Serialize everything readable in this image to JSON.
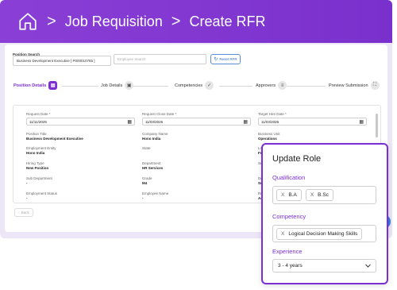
{
  "header": {
    "breadcrumbs": [
      "Job Requisition",
      "Create RFR"
    ]
  },
  "search": {
    "position_label": "Position Search",
    "position_value": "Business Development Executive [ P000010765 ]",
    "employee_placeholder": "Employee Search",
    "reset_label": "Reset RFR"
  },
  "steps": [
    {
      "label": "Position Details",
      "icon": "document-icon",
      "active": true
    },
    {
      "label": "Job Details",
      "icon": "briefcase-icon",
      "active": false
    },
    {
      "label": "Competencies",
      "icon": "check-circle-icon",
      "active": false
    },
    {
      "label": "Approvers",
      "icon": "list-icon",
      "active": false
    },
    {
      "label": "Preview Submission",
      "icon": "expand-icon",
      "active": false
    }
  ],
  "form": {
    "request_date_label": "Request Date *",
    "request_date_value": "11/11/2025",
    "close_date_label": "Request Close Date *",
    "close_date_value": "11/03/2026",
    "hire_date_label": "Target Hire Date *",
    "hire_date_value": "11/03/2026",
    "position_title_label": "Position Title",
    "position_title_value": "Business Development Executive",
    "company_name_label": "Company Name",
    "company_name_value": "Hono India",
    "business_unit_label": "Business Unit",
    "business_unit_value": "Operations",
    "employment_entity_label": "Employment Entity",
    "employment_entity_value": "Hono India",
    "state_label": "State",
    "state_value": "",
    "location_label": "Loca",
    "location_value": "Fran",
    "hiring_type_label": "Hiring Type",
    "hiring_type_value": "New Position",
    "department_label": "Department",
    "department_value": "HR Services",
    "section_label": "Secti",
    "sub_department_label": "Sub Department",
    "sub_department_value": "-",
    "grade_label": "Grade",
    "grade_value": "M4",
    "designation_label": "Desi",
    "designation_value": "Seni",
    "employment_status_label": "Employment Status",
    "employment_status_value": "-",
    "employee_name_label": "Employee Name",
    "employee_name_value": "-",
    "role_label": "Role",
    "role_value": "Assis"
  },
  "back_label": "Back",
  "panel": {
    "title": "Update Role",
    "qualification_label": "Qualification",
    "qualifications": [
      "B.A",
      "B.Sc"
    ],
    "competency_label": "Competency",
    "competencies": [
      "Logical Decision Making Skills"
    ],
    "experience_label": "Experience",
    "experience_value": "3 - 4 years"
  },
  "colors": {
    "accent": "#7b2fd3",
    "header": "#8a3fd6",
    "reset_blue": "#2d6cc4"
  }
}
